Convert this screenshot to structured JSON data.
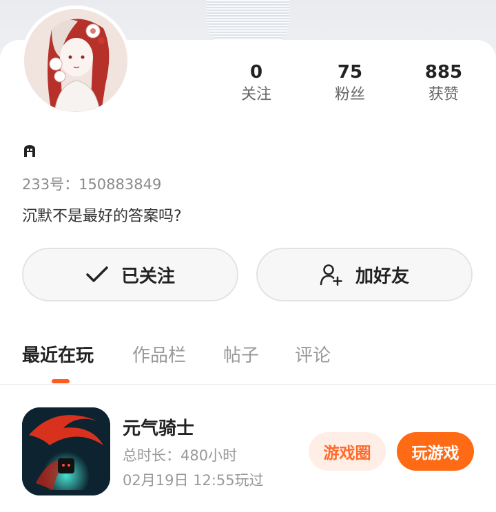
{
  "profile": {
    "uid_label": "233号：150883849",
    "bio": "沉默不是最好的答案吗?"
  },
  "stats": [
    {
      "value": "0",
      "label": "关注"
    },
    {
      "value": "75",
      "label": "粉丝"
    },
    {
      "value": "885",
      "label": "获赞"
    }
  ],
  "actions": {
    "follow_label": "已关注",
    "add_friend_label": "加好友"
  },
  "tabs": [
    {
      "label": "最近在玩",
      "active": true
    },
    {
      "label": "作品栏",
      "active": false
    },
    {
      "label": "帖子",
      "active": false
    },
    {
      "label": "评论",
      "active": false
    }
  ],
  "game": {
    "name": "元气骑士",
    "total_time": "总时长：480小时",
    "last_played": "02月19日 12:55玩过",
    "circle_label": "游戏圈",
    "play_label": "玩游戏"
  },
  "colors": {
    "accent": "#ff6a14",
    "accent_light": "#ffeee6",
    "tab_indicator": "#ff5a1f"
  },
  "icons": {
    "follow": "check-icon",
    "add_friend": "add-user-icon",
    "nickname": "nickname-glyph-icon"
  }
}
